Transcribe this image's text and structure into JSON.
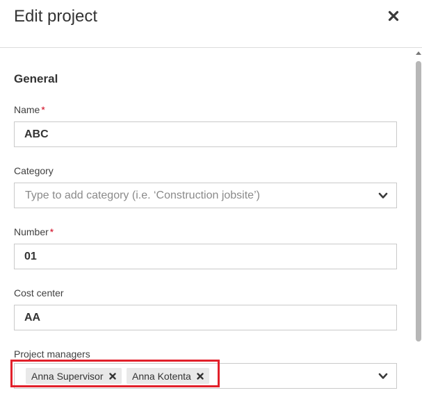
{
  "dialog": {
    "title": "Edit project"
  },
  "section": {
    "title": "General"
  },
  "fields": {
    "name": {
      "label": "Name",
      "required": "*",
      "value": "ABC"
    },
    "category": {
      "label": "Category",
      "placeholder": "Type to add category (i.e. ‘Construction jobsite’)"
    },
    "number": {
      "label": "Number",
      "required": "*",
      "value": "01"
    },
    "cost_center": {
      "label": "Cost center",
      "value": "AA"
    },
    "project_managers": {
      "label": "Project managers",
      "tags": [
        "Anna Supervisor",
        "Anna Kotenta"
      ]
    }
  },
  "colors": {
    "required": "#d0021b",
    "highlight": "#e2202a",
    "tag_bg": "#e9e9e9"
  },
  "icons": {
    "close": "close-icon",
    "dropdown": "chevron-down-icon",
    "tag_remove": "close-icon"
  }
}
